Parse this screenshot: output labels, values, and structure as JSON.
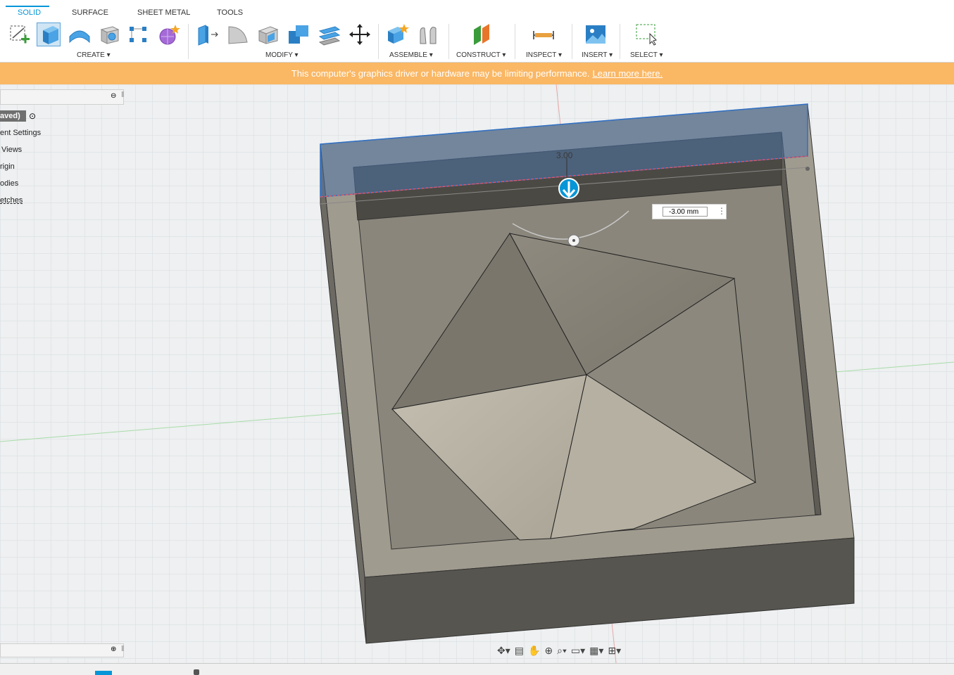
{
  "tabs": [
    {
      "label": "SOLID",
      "active": true
    },
    {
      "label": "SURFACE",
      "active": false
    },
    {
      "label": "SHEET METAL",
      "active": false
    },
    {
      "label": "TOOLS",
      "active": false
    }
  ],
  "groups": {
    "create": "CREATE ▾",
    "modify": "MODIFY ▾",
    "assemble": "ASSEMBLE ▾",
    "construct": "CONSTRUCT ▾",
    "inspect": "INSPECT ▾",
    "insert": "INSERT ▾",
    "select": "SELECT ▾"
  },
  "banner": {
    "text": "This computer's graphics driver or hardware may be limiting performance.",
    "link": "Learn more here."
  },
  "browser": {
    "doc_label": "aved)",
    "items": [
      "ent Settings",
      "Views",
      "rigin",
      "odies",
      "etches"
    ]
  },
  "viewport": {
    "dimension_label": "3.00",
    "input_value": "-3.00 mm"
  },
  "colors": {
    "accent": "#0696d7",
    "banner": "#fab764",
    "selection": "#5b7fae"
  },
  "icons": [
    "sketch-icon",
    "extrude-icon",
    "revolve-icon",
    "hole-icon",
    "pattern-icon",
    "form-icon",
    "press-pull-icon",
    "fillet-icon",
    "shell-icon",
    "combine-icon",
    "offset-icon",
    "move-icon",
    "new-component-icon",
    "joint-icon",
    "plane-icon",
    "measure-icon",
    "insert-image-icon",
    "select-icon"
  ]
}
